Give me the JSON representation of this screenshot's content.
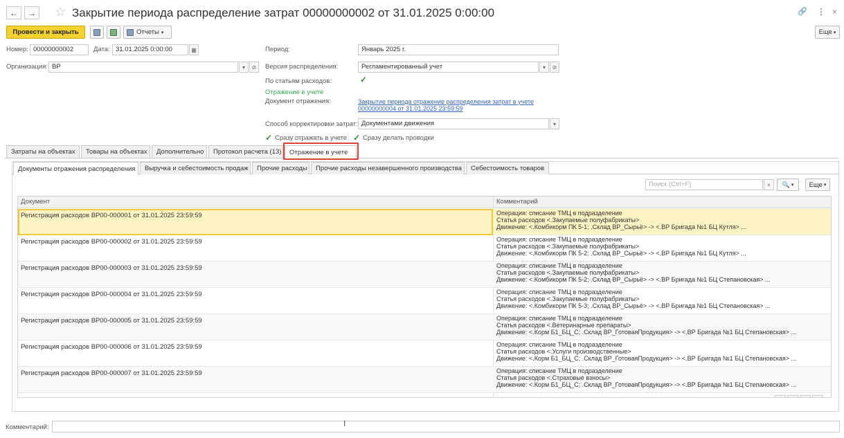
{
  "window": {
    "title": "Закрытие периода распределение затрат 00000000002 от 31.01.2025 0:00:00",
    "back": "←",
    "forward": "→",
    "link_icon": "🔗",
    "menu_icon": "⋮",
    "close_icon": "×"
  },
  "toolbar": {
    "post_close": "Провести и закрыть",
    "reports": "Отчеты",
    "more": "Еще"
  },
  "form": {
    "number_label": "Номер:",
    "number_value": "00000000002",
    "date_label": "Дата:",
    "date_value": "31.01.2025 0:00:00",
    "org_label": "Организация:",
    "org_value": "ВР",
    "period_label": "Период:",
    "period_value": "Январь 2025 г.",
    "version_label": "Версия распределения:",
    "version_value": "Регламентированный учет",
    "by_items_label": "По статьям расходов:",
    "accounting_header": "Отражение в учете",
    "doc_label": "Документ отражения:",
    "doc_link_1": "Закрытие периода отражение распределения затрат в учете",
    "doc_link_2": "00000000004 от 31.01.2025 23:59:59",
    "correction_label": "Способ корректировки затрат:",
    "correction_value": "Документами движения",
    "reflect_now": "Сразу отражать в учете",
    "post_now": "Сразу делать проводки"
  },
  "tabs": [
    {
      "label": "Затраты на объектах"
    },
    {
      "label": "Товары на объектах"
    },
    {
      "label": "Дополнительно"
    },
    {
      "label": "Протокол расчета (13)"
    },
    {
      "label": "Отражение в учете"
    }
  ],
  "subtabs": [
    {
      "label": "Документы отражения распределения"
    },
    {
      "label": "Выручка и себестоимость продаж"
    },
    {
      "label": "Прочие расходы"
    },
    {
      "label": "Прочие расходы незавершенного производства"
    },
    {
      "label": "Себестоимость товаров"
    }
  ],
  "search": {
    "placeholder": "Поиск (Ctrl+F)",
    "clear": "×",
    "find": "🔍",
    "more": "Еще"
  },
  "table": {
    "columns": [
      "Документ",
      "Комментарий"
    ],
    "rows": [
      {
        "doc": "Регистрация расходов ВР00-000001 от 31.01.2025 23:59:59",
        "c1": "Операция: списание ТМЦ в подразделение",
        "c2": "Статья расходов <.Закупаемые полуфабрикаты>",
        "c3": "Движение: <.Комбикорм ПК 5-1; .Склад ВР_Сырьё> -> <.ВР Бригада №1 БЦ Кутля> ..."
      },
      {
        "doc": "Регистрация расходов ВР00-000002 от 31.01.2025 23:59:59",
        "c1": "Операция: списание ТМЦ в подразделение",
        "c2": "Статья расходов <.Закупаемые полуфабрикаты>",
        "c3": "Движение: <.Комбикорм ПК 5-2; .Склад ВР_Сырьё> -> <.ВР Бригада №1 БЦ Кутля> ..."
      },
      {
        "doc": "Регистрация расходов ВР00-000003 от 31.01.2025 23:59:59",
        "c1": "Операция: списание ТМЦ в подразделение",
        "c2": "Статья расходов <.Закупаемые полуфабрикаты>",
        "c3": "Движение: <.Комбикорм ПК 5-2; .Склад ВР_Сырьё> -> <.ВР Бригада №1 БЦ Степановская> ..."
      },
      {
        "doc": "Регистрация расходов ВР00-000004 от 31.01.2025 23:59:59",
        "c1": "Операция: списание ТМЦ в подразделение",
        "c2": "Статья расходов <.Закупаемые полуфабрикаты>",
        "c3": "Движение: <.Комбикорм ПК 5-3; .Склад ВР_Сырьё> -> <.ВР Бригада №1 БЦ Степановская> ..."
      },
      {
        "doc": "Регистрация расходов ВР00-000005 от 31.01.2025 23:59:59",
        "c1": "Операция: списание ТМЦ в подразделение",
        "c2": "Статья расходов <.Ветеринарные препараты>",
        "c3": "Движение: <.Корм Б1_БЦ_С; .Склад ВР_ГотоваяПродукция> -> <.ВР Бригада №1 БЦ Степановская> ..."
      },
      {
        "doc": "Регистрация расходов ВР00-000006 от 31.01.2025 23:59:59",
        "c1": "Операция: списание ТМЦ в подразделение",
        "c2": "Статья расходов <.Услуги производственные>",
        "c3": "Движение: <.Корм Б1_БЦ_С; .Склад ВР_ГотоваяПродукция> -> <.ВР Бригада №1 БЦ Степановская> ..."
      },
      {
        "doc": "Регистрация расходов ВР00-000007 от 31.01.2025 23:59:59",
        "c1": "Операция: списание ТМЦ в подразделение",
        "c2": "Статья расходов <.Страховые взносы>",
        "c3": "Движение: <.Корм Б1_БЦ_С; .Склад ВР_ГотоваяПродукция> -> <.ВР Бригада №1 БЦ Степановская> ..."
      }
    ]
  },
  "footer": {
    "comment_label": "Комментарий:"
  }
}
